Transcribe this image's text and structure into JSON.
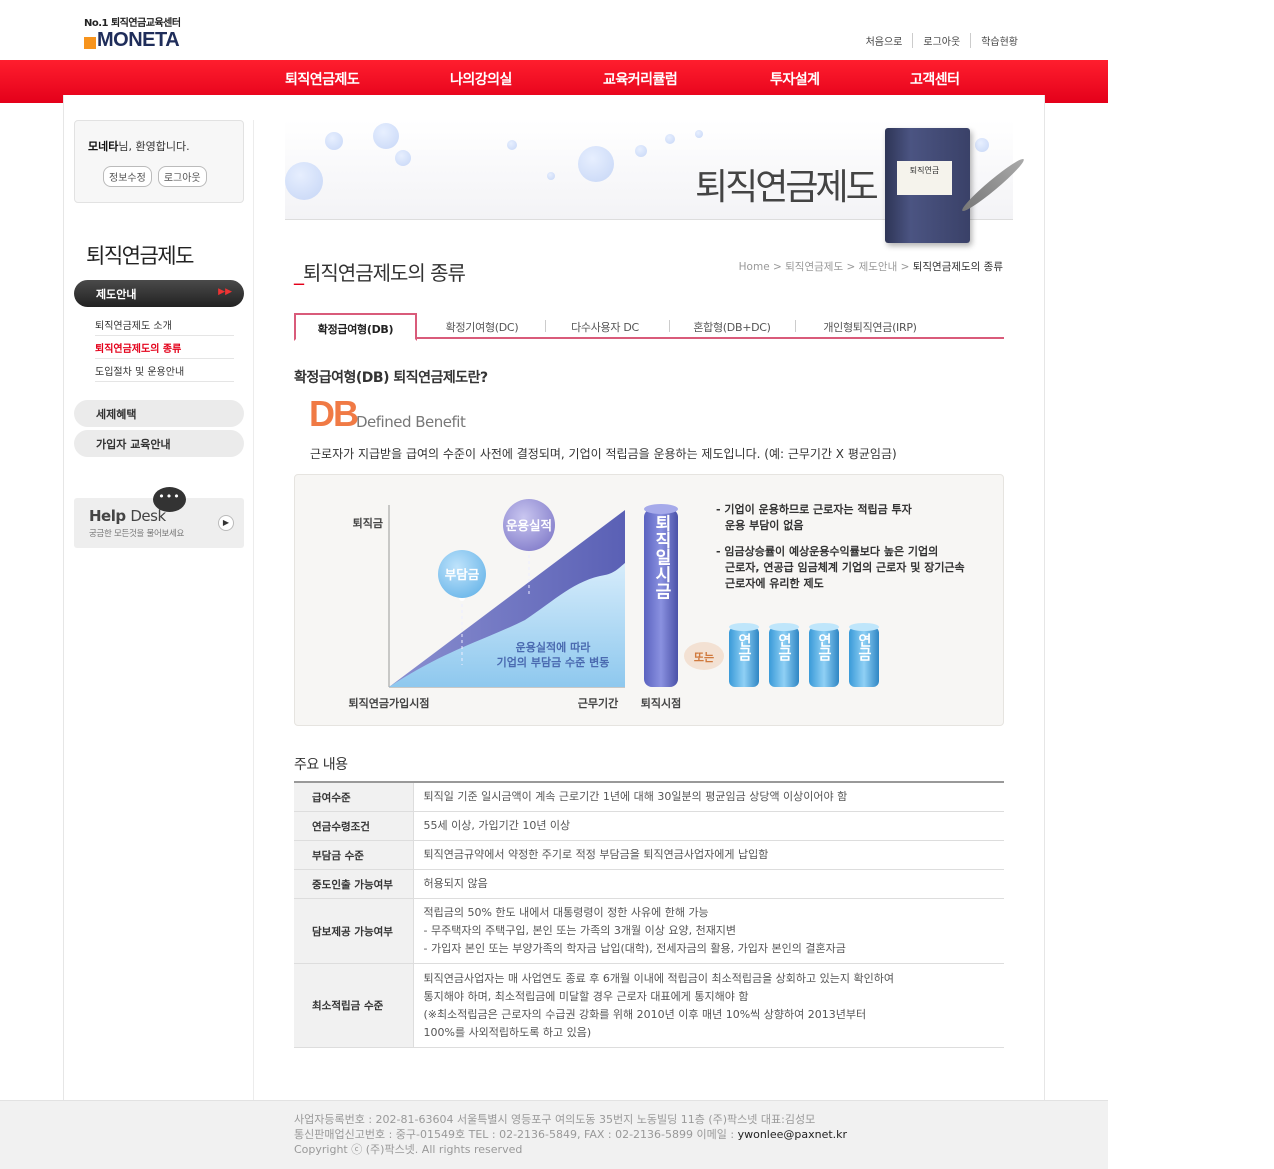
{
  "header": {
    "logo_tag": "No.1 퇴직연금교육센터",
    "logo_name": "MONETA",
    "links": [
      "처음으로",
      "로그아웃",
      "학습현황"
    ]
  },
  "nav": [
    "퇴직연금제도",
    "나의강의실",
    "교육커리큘럼",
    "투자설계",
    "고객센터"
  ],
  "login": {
    "user": "모네타",
    "welcome_suffix": "님, 환영합니다.",
    "edit_btn": "정보수정",
    "logout_btn": "로그아웃"
  },
  "sidebar": {
    "title": "퇴직연금제도",
    "active": "제도안내",
    "subitems": [
      "퇴직연금제도 소개",
      "퇴직연금제도의 종류",
      "도입절차 및 운용안내"
    ],
    "items": [
      "세제혜택",
      "가입자 교육안내"
    ],
    "help_title": "Help",
    "help_title2": "Desk",
    "help_sub": "궁금한 모든것을 물어보세요"
  },
  "banner": {
    "title": "퇴직연금제도",
    "book_label": "퇴직연금"
  },
  "page": {
    "title": "퇴직연금제도의 종류",
    "breadcrumb": [
      "Home",
      "퇴직연금제도",
      "제도안내",
      "퇴직연금제도의 종류"
    ]
  },
  "tabs": [
    "확정급여형(DB)",
    "확정기여형(DC)",
    "다수사용자 DC",
    "혼합형(DB+DC)",
    "개인형퇴직연금(IRP)"
  ],
  "content": {
    "heading": "확정급여형(DB) 퇴직연금제도란?",
    "db_abbr": "DB",
    "db_full": "Defined Benefit",
    "description": "근로자가 지급받을 급여의 수준이 사전에 결정되며, 기업이 적립금을 운용하는 제도입니다. (예: 근무기간 X 평균임금)"
  },
  "diagram": {
    "y_label": "퇴직금",
    "x_start": "퇴직연금가입시점",
    "x_end": "근무기간",
    "retire_point": "퇴직시점",
    "bubble_1": "부담금",
    "bubble_2": "운용실적",
    "area_note_1": "운용실적에 따라",
    "area_note_2": "기업의 부담금 수준 변동",
    "lump_sum": "퇴직일시금",
    "or": "또는",
    "pension": "연금",
    "note_1_a": "- 기업이 운용하므로 근로자는 적립금 투자",
    "note_1_b": "운용 부담이 없음",
    "note_2_a": "- 임금상승률이 예상운용수익률보다 높은 기업의",
    "note_2_b": "근로자, 연공급 임금체계 기업의 근로자 및 장기근속",
    "note_2_c": "근로자에 유리한 제도"
  },
  "main_section": {
    "heading": "주요 내용",
    "rows": [
      {
        "key": "급여수준",
        "lines": [
          "퇴직일 기준 일시금액이 계속 근로기간 1년에 대해 30일분의 평균임금 상당액 이상이어야 함"
        ]
      },
      {
        "key": "연금수령조건",
        "lines": [
          "55세 이상, 가입기간 10년 이상"
        ]
      },
      {
        "key": "부담금 수준",
        "lines": [
          "퇴직연금규약에서 약정한 주기로 적정 부담금을 퇴직연금사업자에게 납입함"
        ]
      },
      {
        "key": "중도인출 가능여부",
        "lines": [
          "허용되지 않음"
        ]
      },
      {
        "key": "담보제공 가능여부",
        "lines": [
          "적립금의 50% 한도 내에서 대통령령이 정한 사유에 한해 가능",
          "- 무주택자의 주택구입, 본인 또는 가족의 3개월 이상 요양, 천재지변",
          "- 가입자 본인 또는 부양가족의 학자금 납입(대학), 전세자금의 활용, 가입자 본인의 결혼자금"
        ]
      },
      {
        "key": "최소적립금 수준",
        "lines": [
          "퇴직연금사업자는 매 사업연도 종료 후 6개월 이내에 적립금이 최소적립금을 상회하고 있는지 확인하여",
          "통지해야 하며, 최소적립금에 미달할 경우 근로자 대표에게 통지해야 함",
          "(※최소적립금은 근로자의 수급권 강화를 위해 2010년 이후 매년 10%씩 상향하여 2013년부터",
          "100%를 사외적립하도록 하고 있음)"
        ]
      }
    ]
  },
  "footer": {
    "line1": "사업자등록번호 : 202-81-63604 서울특별시 영등포구 여의도동 35번지 노동빌딩 11층 (주)팍스넷 대표:김성모",
    "line2": "통신판매업신고번호 : 중구-01549호 TEL : 02-2136-5849, FAX : 02-2136-5899 이메일 : ",
    "email": "ywonlee@paxnet.kr",
    "line3": "Copyright ⓒ (주)팍스넷. All rights reserved"
  }
}
